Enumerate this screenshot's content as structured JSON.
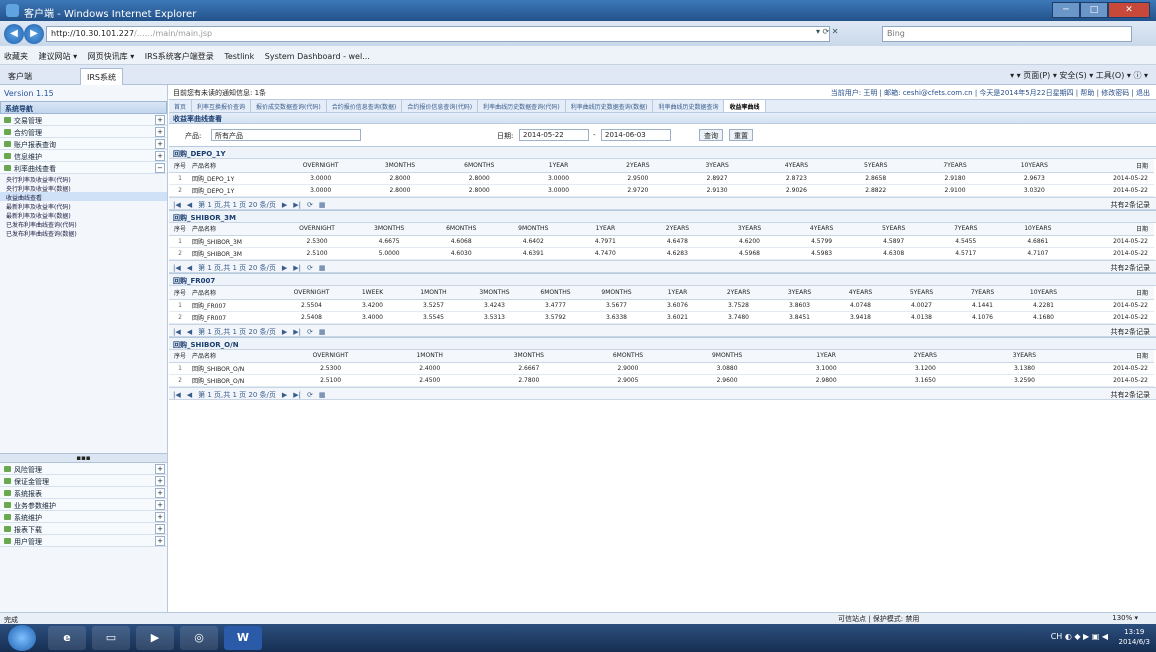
{
  "window": {
    "title": "客户端 - Windows Internet Explorer",
    "min": "─",
    "max": "□",
    "close": "✕"
  },
  "browser": {
    "url": "http://10.30.101.227",
    "url_rest": "/……/main/main.jsp",
    "search_placeholder": "Bing",
    "nav_back": "◀",
    "nav_fwd": "▶",
    "addr_controls": "▾ ⟳ ✕"
  },
  "favorites": {
    "items": [
      "收藏夹",
      "建议网站 ▾",
      "网页快讯库 ▾",
      "IRS系统客户端登录",
      "Testlink",
      "System Dashboard - wel..."
    ]
  },
  "tabs": [
    {
      "label": "客户端"
    },
    {
      "label": "IRS系统"
    }
  ],
  "cmdbar": "▾ ▾ 页面(P) ▾ 安全(S) ▾ 工具(O) ▾ ⓘ ▾",
  "sidebar": {
    "version": "Version 1.15",
    "header": "系统导航",
    "items": [
      {
        "label": "交易管理"
      },
      {
        "label": "合约管理"
      },
      {
        "label": "账户报表查询"
      },
      {
        "label": "信息维护"
      },
      {
        "label": "利率曲线查看"
      }
    ],
    "subitems": [
      {
        "label": "央行利率及收益率(代码)"
      },
      {
        "label": "央行利率及收益率(数据)"
      },
      {
        "label": "收益曲线查看"
      },
      {
        "label": "最新利率及收益率(代码)"
      },
      {
        "label": "最新利率及收益率(数据)"
      },
      {
        "label": "已发布利率曲线查询(代码)"
      },
      {
        "label": "已发布利率曲线查询(数据)"
      }
    ],
    "splitter": "▪▪▪",
    "bottom_items": [
      {
        "label": "风险管理"
      },
      {
        "label": "保证金管理"
      },
      {
        "label": "系统报表"
      },
      {
        "label": "业务参数维护"
      },
      {
        "label": "系统维护"
      },
      {
        "label": "报表下载"
      },
      {
        "label": "用户管理"
      }
    ]
  },
  "main": {
    "notice": "目前您有未读的通知信息: 1条",
    "notice_right": "当前用户: 王明 | 邮箱: ceshi@cfets.com.cn | 今天是2014年5月22日星期四 | 帮助 | 修改密码 | 退出",
    "subtabs": [
      "首页",
      "利率互换报价查询",
      "报价成交数据查询(代码)",
      "合约报价信息查询(数据)",
      "合约报价信息查询(代码)",
      "利率曲线历史数据查询(代码)",
      "利率曲线历史数据查询(数据)",
      "利率曲线历史数据查询",
      "收益率曲线"
    ],
    "panel_title": "收益率曲线查看",
    "filter": {
      "product_label": "产品:",
      "product_value": "所有产品",
      "date_label": "日期:",
      "start": "2014-05-22",
      "end": "2014-06-03",
      "query": "查询",
      "reset": "重置",
      "sep": "-"
    }
  },
  "grids": [
    {
      "title": "回购_DEPO_1Y",
      "headers": [
        "序号",
        "产品名称",
        "OVERNIGHT",
        "3MONTHS",
        "6MONTHS",
        "1YEAR",
        "2YEARS",
        "3YEARS",
        "4YEARS",
        "5YEARS",
        "7YEARS",
        "10YEARS",
        "日期"
      ],
      "rows": [
        [
          "1",
          "回购_DEPO_1Y",
          "3.0000",
          "2.8000",
          "2.8000",
          "3.0000",
          "2.9500",
          "2.8927",
          "2.8723",
          "2.8658",
          "2.9180",
          "2.9673",
          "2014-05-22"
        ],
        [
          "2",
          "回购_DEPO_1Y",
          "3.0000",
          "2.8000",
          "2.8000",
          "3.0000",
          "2.9720",
          "2.9130",
          "2.9026",
          "2.8822",
          "2.9100",
          "3.0320",
          "2014-05-22"
        ]
      ],
      "pager": "第 1 页,共 1 页  20 条/页",
      "record": "共有2条记录"
    },
    {
      "title": "回购_SHIBOR_3M",
      "headers": [
        "序号",
        "产品名称",
        "OVERNIGHT",
        "3MONTHS",
        "6MONTHS",
        "9MONTHS",
        "1YEAR",
        "2YEARS",
        "3YEARS",
        "4YEARS",
        "5YEARS",
        "7YEARS",
        "10YEARS",
        "日期"
      ],
      "rows": [
        [
          "1",
          "回购_SHIBOR_3M",
          "2.5300",
          "4.6675",
          "4.6068",
          "4.6402",
          "4.7971",
          "4.6478",
          "4.6200",
          "4.5799",
          "4.5897",
          "4.5455",
          "4.6861",
          "2014-05-22"
        ],
        [
          "2",
          "回购_SHIBOR_3M",
          "2.5100",
          "5.0000",
          "4.6030",
          "4.6391",
          "4.7470",
          "4.6283",
          "4.5968",
          "4.5983",
          "4.6308",
          "4.5717",
          "4.7107",
          "2014-05-22"
        ]
      ],
      "pager": "第 1 页,共 1 页  20 条/页",
      "record": "共有2条记录"
    },
    {
      "title": "回购_FR007",
      "headers": [
        "序号",
        "产品名称",
        "OVERNIGHT",
        "1WEEK",
        "1MONTH",
        "3MONTHS",
        "6MONTHS",
        "9MONTHS",
        "1YEAR",
        "2YEARS",
        "3YEARS",
        "4YEARS",
        "5YEARS",
        "7YEARS",
        "10YEARS",
        "日期"
      ],
      "rows": [
        [
          "1",
          "回购_FR007",
          "2.5504",
          "3.4200",
          "3.5257",
          "3.4243",
          "3.4777",
          "3.5677",
          "3.6076",
          "3.7528",
          "3.8603",
          "4.0748",
          "4.0027",
          "4.1441",
          "4.2281",
          "2014-05-22"
        ],
        [
          "2",
          "回购_FR007",
          "2.5408",
          "3.4000",
          "3.5545",
          "3.5313",
          "3.5792",
          "3.6338",
          "3.6021",
          "3.7480",
          "3.8451",
          "3.9418",
          "4.0138",
          "4.1076",
          "4.1680",
          "2014-05-22"
        ]
      ],
      "pager": "第 1 页,共 1 页  20 条/页",
      "record": "共有2条记录"
    },
    {
      "title": "回购_SHIBOR_O/N",
      "headers": [
        "序号",
        "产品名称",
        "OVERNIGHT",
        "1MONTH",
        "3MONTHS",
        "6MONTHS",
        "9MONTHS",
        "1YEAR",
        "2YEARS",
        "3YEARS",
        "日期"
      ],
      "rows": [
        [
          "1",
          "回购_SHIBOR_O/N",
          "2.5300",
          "2.4000",
          "2.6667",
          "2.9000",
          "3.0880",
          "3.1000",
          "3.1200",
          "3.1380",
          "2014-05-22"
        ],
        [
          "2",
          "回购_SHIBOR_O/N",
          "2.5100",
          "2.4500",
          "2.7800",
          "2.9005",
          "2.9600",
          "2.9800",
          "3.1650",
          "3.2590",
          "2014-05-22"
        ]
      ],
      "pager": "第 1 页,共 1 页  20 条/页",
      "record": "共有2条记录"
    }
  ],
  "statusbar": {
    "left": "完成",
    "mid": "可信站点 | 保护模式: 禁用",
    "zoom": "130% ▾"
  },
  "taskbar": {
    "word": "W",
    "time": "13:19",
    "date": "2014/6/3",
    "tray": "CH ◐ ◆ ▶ ▣ ◀"
  }
}
